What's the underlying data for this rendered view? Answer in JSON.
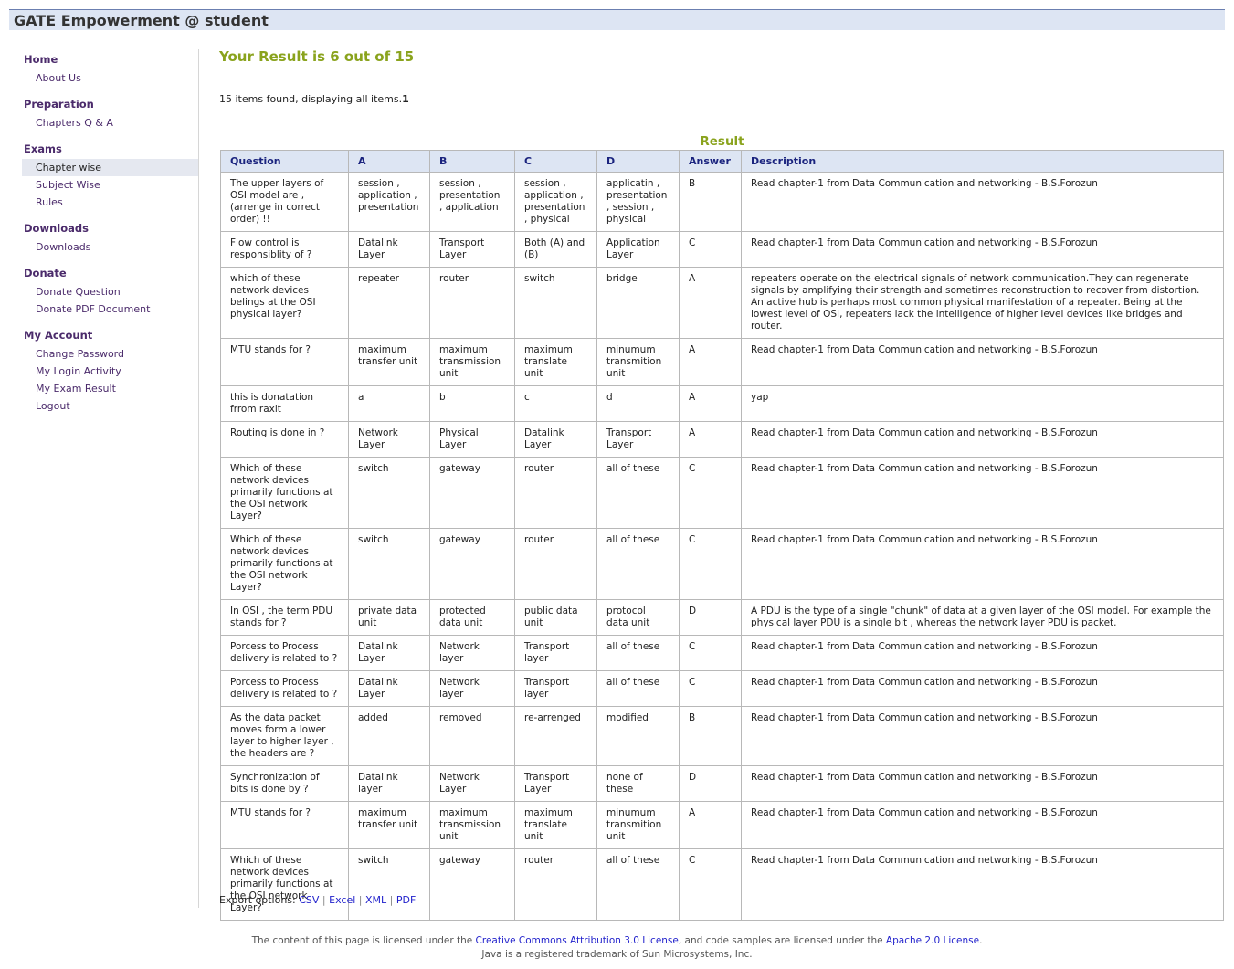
{
  "header": {
    "title": "GATE Empowerment @ student"
  },
  "sidebar": [
    {
      "label": "Home",
      "items": [
        "About Us"
      ]
    },
    {
      "label": "Preparation",
      "items": [
        "Chapters Q & A"
      ]
    },
    {
      "label": "Exams",
      "items": [
        "Chapter wise",
        "Subject Wise",
        "Rules"
      ]
    },
    {
      "label": "Downloads",
      "items": [
        "Downloads"
      ]
    },
    {
      "label": "Donate",
      "items": [
        "Donate Question",
        "Donate PDF Document"
      ]
    },
    {
      "label": "My Account",
      "items": [
        "Change Password",
        "My Login Activity",
        "My Exam Result",
        "Logout"
      ]
    }
  ],
  "sidebar_active": "Chapter wise",
  "main": {
    "result_title": "Your Result is 6 out of 15",
    "found_text": "15 items found, displaying all items.",
    "found_page": "1",
    "caption": "Result",
    "columns": [
      "Question",
      "A",
      "B",
      "C",
      "D",
      "Answer",
      "Description"
    ],
    "rows": [
      [
        "The upper layers of OSI model are , (arrenge in correct order) !!",
        "session , application , presentation",
        "session , presentation , application",
        "session , application , presentation , physical",
        "applicatin , presentation , session , physical",
        "B",
        "Read chapter-1 from Data Communication and networking - B.S.Forozun"
      ],
      [
        "Flow control is responsiblity of ?",
        "Datalink Layer",
        "Transport Layer",
        "Both (A) and (B)",
        "Application Layer",
        "C",
        "Read chapter-1 from Data Communication and networking - B.S.Forozun"
      ],
      [
        "which of these network devices belings at the OSI physical layer?",
        "repeater",
        "router",
        "switch",
        "bridge",
        "A",
        "repeaters operate on the electrical signals of network communication.They can regenerate signals by amplifying their strength and sometimes reconstruction to recover from distortion. An active hub is perhaps most common physical manifestation of a repeater. Being at the lowest level of OSI, repeaters lack the intelligence of higher level devices like bridges and router."
      ],
      [
        "MTU stands for ?",
        "maximum transfer unit",
        "maximum transmission unit",
        "maximum translate unit",
        "minumum transmition unit",
        "A",
        "Read chapter-1 from Data Communication and networking - B.S.Forozun"
      ],
      [
        "this is donatation frrom raxit",
        "a",
        "b",
        "c",
        "d",
        "A",
        "yap"
      ],
      [
        "Routing is done in ?",
        "Network Layer",
        "Physical Layer",
        "Datalink Layer",
        "Transport Layer",
        "A",
        "Read chapter-1 from Data Communication and networking - B.S.Forozun"
      ],
      [
        "Which of these network devices primarily functions at the OSI network Layer?",
        "switch",
        "gateway",
        "router",
        "all of these",
        "C",
        "Read chapter-1 from Data Communication and networking - B.S.Forozun"
      ],
      [
        "Which of these network devices primarily functions at the OSI network Layer?",
        "switch",
        "gateway",
        "router",
        "all of these",
        "C",
        "Read chapter-1 from Data Communication and networking - B.S.Forozun"
      ],
      [
        "In OSI , the term PDU stands for ?",
        "private data unit",
        "protected data unit",
        "public data unit",
        "protocol data unit",
        "D",
        "A PDU is the type of a single \"chunk\" of data at a given layer of the OSI model. For example the physical layer PDU is a single bit , whereas the network layer PDU is packet."
      ],
      [
        "Porcess to Process delivery is related to ?",
        "Datalink Layer",
        "Network layer",
        "Transport layer",
        "all of these",
        "C",
        "Read chapter-1 from Data Communication and networking - B.S.Forozun"
      ],
      [
        "Porcess to Process delivery is related to ?",
        "Datalink Layer",
        "Network layer",
        "Transport layer",
        "all of these",
        "C",
        "Read chapter-1 from Data Communication and networking - B.S.Forozun"
      ],
      [
        "As the data packet moves form a lower layer to higher layer , the headers are ?",
        "added",
        "removed",
        "re-arrenged",
        "modified",
        "B",
        "Read chapter-1 from Data Communication and networking - B.S.Forozun"
      ],
      [
        "Synchronization of bits is done by ?",
        "Datalink layer",
        "Network Layer",
        "Transport Layer",
        "none of these",
        "D",
        "Read chapter-1 from Data Communication and networking - B.S.Forozun"
      ],
      [
        "MTU stands for ?",
        "maximum transfer unit",
        "maximum transmission unit",
        "maximum translate unit",
        "minumum transmition unit",
        "A",
        "Read chapter-1 from Data Communication and networking - B.S.Forozun"
      ],
      [
        "Which of these network devices primarily functions at the OSI network Layer?",
        "switch",
        "gateway",
        "router",
        "all of these",
        "C",
        "Read chapter-1 from Data Communication and networking - B.S.Forozun"
      ]
    ],
    "export": {
      "label": "Export options:",
      "options": [
        "CSV",
        "Excel",
        "XML",
        "PDF"
      ]
    }
  },
  "footer": {
    "line1_pre": "The content of this page is licensed under the ",
    "link1": "Creative Commons Attribution 3.0 License",
    "line1_mid": ", and code samples are licensed under the ",
    "link2": "Apache 2.0 License",
    "line1_end": ".",
    "line2": "Java is a registered trademark of Sun Microsystems, Inc."
  }
}
